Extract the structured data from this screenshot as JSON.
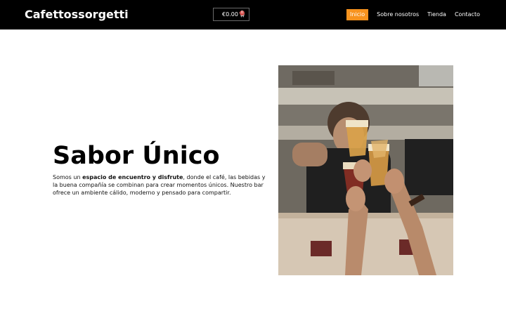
{
  "header": {
    "brand": "Cafettossorgetti",
    "cart": {
      "total": "€0.00",
      "count": "0"
    },
    "nav": [
      {
        "label": "Inicio",
        "active": true
      },
      {
        "label": "Sobre nosotros",
        "active": false
      },
      {
        "label": "Tienda",
        "active": false
      },
      {
        "label": "Contacto",
        "active": false
      }
    ]
  },
  "hero": {
    "title": "Sabor Único",
    "text_before": "Somos un ",
    "text_bold": "espacio de encuentro y disfrute",
    "text_after": ", donde el café, las bebidas y la buena compañía se combinan para crear momentos únicos. Nuestro bar ofrece un ambiente cálido, moderno y pensado para compartir."
  },
  "colors": {
    "header_bg": "#000000",
    "accent": "#f7931e",
    "badge": "#d9534f"
  },
  "icons": [
    "cart-icon"
  ]
}
